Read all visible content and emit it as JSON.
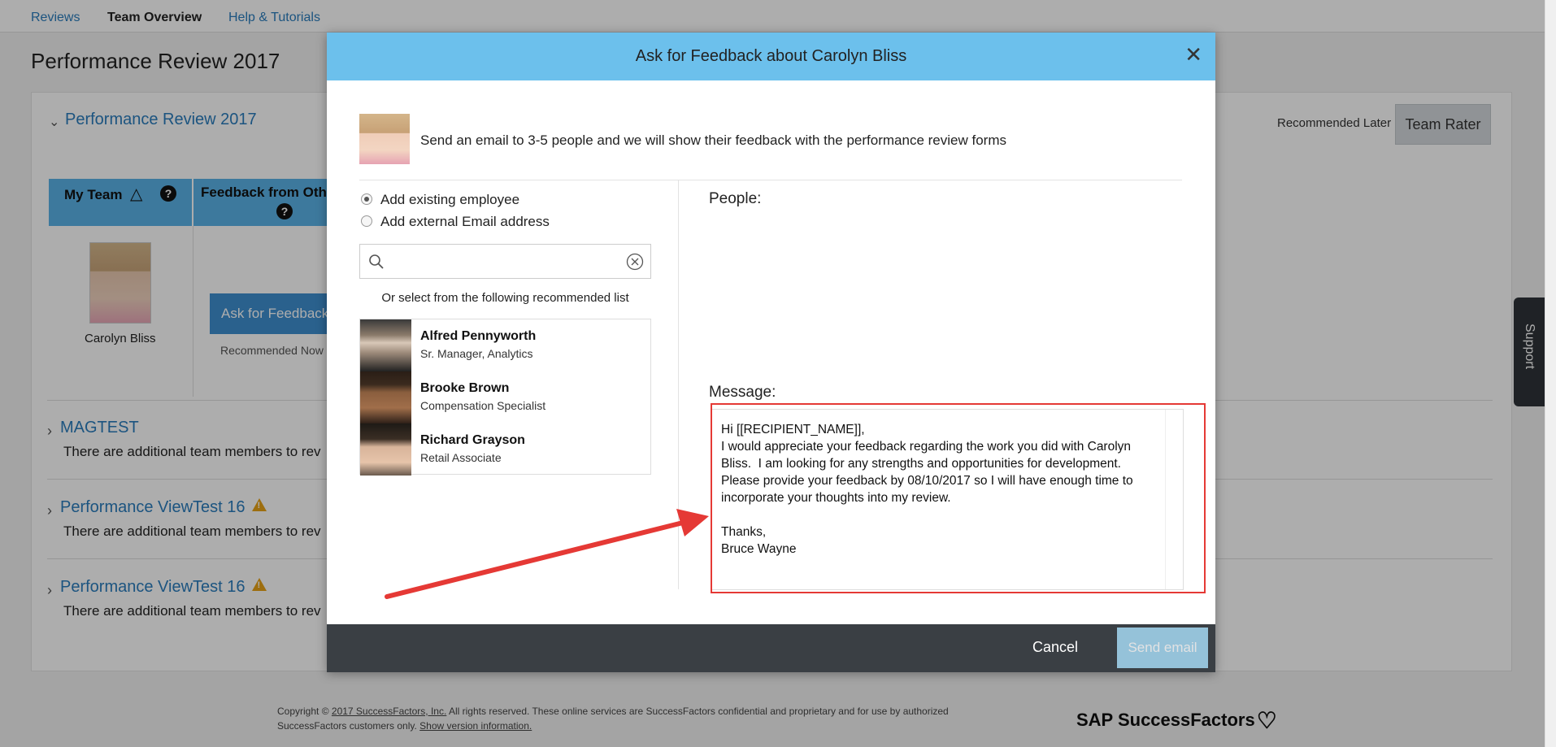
{
  "nav": {
    "items": [
      "Reviews",
      "Team Overview",
      "Help & Tutorials"
    ]
  },
  "page": {
    "title": "Performance Review 2017",
    "section_title": "Performance Review 2017",
    "my_team_label": "My Team",
    "feedback_col_label": "Feedback from Oth",
    "member_name": "Carolyn Bliss",
    "ask_button": "Ask for Feedback",
    "recommended_now": "Recommended Now",
    "recommended_later": "Recommended Later",
    "team_rater": "Team Rater",
    "sections": [
      {
        "title": "MAGTEST",
        "note": "There are additional team members to rev",
        "warning": false
      },
      {
        "title": "Performance ViewTest 16",
        "note": "There are additional team members to rev",
        "warning": true
      },
      {
        "title": "Performance ViewTest 16",
        "note": "There are additional team members to rev",
        "warning": true
      }
    ],
    "support": "Support"
  },
  "footer": {
    "copyright_prefix": "Copyright ©",
    "company_link": "2017 SuccessFactors, Inc.",
    "copyright_rest": " All rights reserved. These online services are SuccessFactors confidential and proprietary and for use by authorized",
    "line2": "SuccessFactors customers only. ",
    "version_link": "Show version information.",
    "brand": "SAP SuccessFactors"
  },
  "dialog": {
    "title": "Ask for Feedback about Carolyn Bliss",
    "intro": "Send an email to 3-5 people and we will show their feedback with the performance review forms",
    "radio_existing": "Add existing employee",
    "radio_external": "Add external Email address",
    "radio_selected": "existing",
    "search": {
      "value": "",
      "placeholder": ""
    },
    "recommended_caption": "Or select from the following recommended list",
    "recommended": [
      {
        "name": "Alfred Pennyworth",
        "role": "Sr. Manager, Analytics"
      },
      {
        "name": "Brooke Brown",
        "role": "Compensation Specialist"
      },
      {
        "name": "Richard Grayson",
        "role": "Retail Associate"
      }
    ],
    "people_label": "People:",
    "message_label": "Message:",
    "message": "Hi [[RECIPIENT_NAME]],\nI would appreciate your feedback regarding the work you did with Carolyn Bliss.  I am looking for any strengths and opportunities for development.  Please provide your feedback by 08/10/2017 so I will have enough time to incorporate your thoughts into my review.\n\nThanks,\nBruce Wayne",
    "cancel": "Cancel",
    "send": "Send email"
  },
  "colors": {
    "header_blue": "#6cc0ec",
    "link_blue": "#2a7dbd",
    "footer_dark": "#3a3f44",
    "annotation_red": "#e53935",
    "warning": "#e8a317"
  }
}
